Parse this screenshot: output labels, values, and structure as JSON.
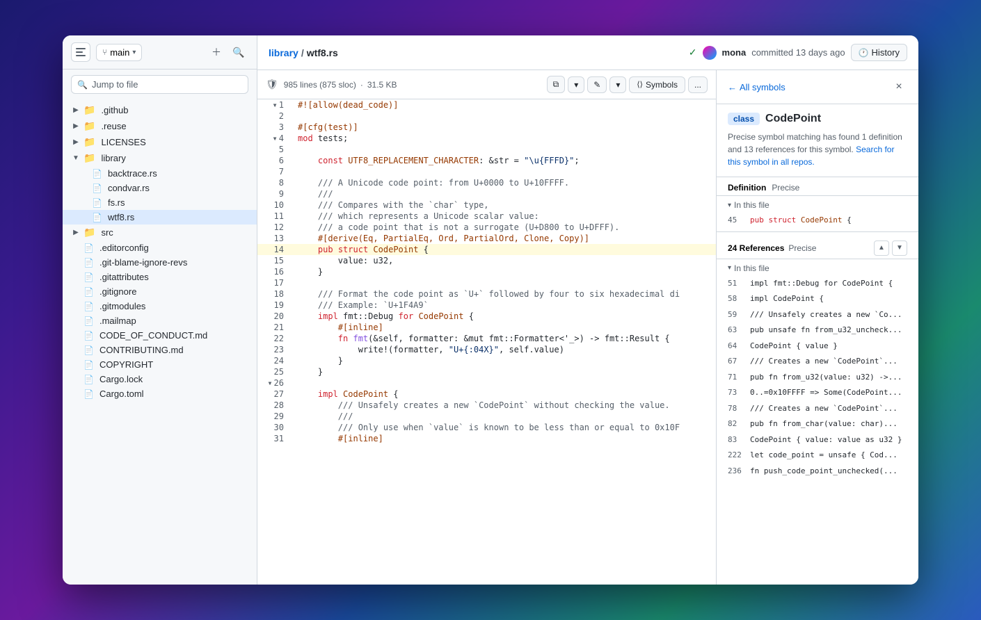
{
  "window": {
    "title": "wtf8.rs"
  },
  "sidebar": {
    "branch": "main",
    "search_placeholder": "Jump to file",
    "items": [
      {
        "id": "github",
        "label": ".github",
        "type": "folder",
        "indent": 0,
        "collapsed": true
      },
      {
        "id": "reuse",
        "label": ".reuse",
        "type": "folder",
        "indent": 0,
        "collapsed": true
      },
      {
        "id": "licenses",
        "label": "LICENSES",
        "type": "folder",
        "indent": 0,
        "collapsed": true
      },
      {
        "id": "library",
        "label": "library",
        "type": "folder",
        "indent": 0,
        "collapsed": false
      },
      {
        "id": "backtrace",
        "label": "backtrace.rs",
        "type": "file",
        "indent": 1
      },
      {
        "id": "condvar",
        "label": "condvar.rs",
        "type": "file",
        "indent": 1
      },
      {
        "id": "fs",
        "label": "fs.rs",
        "type": "file",
        "indent": 1
      },
      {
        "id": "wtf8",
        "label": "wtf8.rs",
        "type": "file",
        "indent": 1,
        "selected": true
      },
      {
        "id": "src",
        "label": "src",
        "type": "folder",
        "indent": 0,
        "collapsed": true
      },
      {
        "id": "editorconfig",
        "label": ".editorconfig",
        "type": "file",
        "indent": 0
      },
      {
        "id": "gitblame",
        "label": ".git-blame-ignore-revs",
        "type": "file",
        "indent": 0
      },
      {
        "id": "gitattributes",
        "label": ".gitattributes",
        "type": "file",
        "indent": 0
      },
      {
        "id": "gitignore",
        "label": ".gitignore",
        "type": "file",
        "indent": 0
      },
      {
        "id": "gitmodules",
        "label": ".gitmodules",
        "type": "file",
        "indent": 0
      },
      {
        "id": "mailmap",
        "label": ".mailmap",
        "type": "file",
        "indent": 0
      },
      {
        "id": "codeofconduct",
        "label": "CODE_OF_CONDUCT.md",
        "type": "file",
        "indent": 0
      },
      {
        "id": "contributing",
        "label": "CONTRIBUTING.md",
        "type": "file",
        "indent": 0
      },
      {
        "id": "copyright",
        "label": "COPYRIGHT",
        "type": "file",
        "indent": 0
      },
      {
        "id": "cargolock",
        "label": "Cargo.lock",
        "type": "file",
        "indent": 0
      },
      {
        "id": "cargotoml",
        "label": "Cargo.toml",
        "type": "file",
        "indent": 0
      }
    ]
  },
  "header": {
    "breadcrumb_base": "library",
    "breadcrumb_sep": "/",
    "breadcrumb_file": "wtf8.rs",
    "commit_user": "mona",
    "commit_time": "committed 13 days ago",
    "history_label": "History"
  },
  "code_toolbar": {
    "lines": "985 lines (875 sloc)",
    "size": "31.5 KB",
    "symbols_label": "Symbols",
    "raw_label": "Raw",
    "edit_label": "Edit",
    "more_label": "..."
  },
  "code_lines": [
    {
      "num": 1,
      "collapsed": true,
      "code": "#![allow(dead_code)]",
      "tokens": [
        {
          "t": "attr",
          "v": "#![allow(dead_code)]"
        }
      ]
    },
    {
      "num": 2,
      "code": ""
    },
    {
      "num": 3,
      "code": "#[cfg(test)]",
      "tokens": [
        {
          "t": "attr",
          "v": "#[cfg(test)]"
        }
      ]
    },
    {
      "num": 4,
      "collapsed": true,
      "code": "mod tests;",
      "tokens": [
        {
          "t": "kw",
          "v": "mod"
        },
        {
          "t": "normal",
          "v": " tests;"
        }
      ]
    },
    {
      "num": 5,
      "code": ""
    },
    {
      "num": 6,
      "code": "    const UTF8_REPLACEMENT_CHARACTER: &str = \"\\u{FFFD}\";",
      "tokens": [
        {
          "t": "normal",
          "v": "    "
        },
        {
          "t": "kw",
          "v": "const"
        },
        {
          "t": "normal",
          "v": " "
        },
        {
          "t": "type",
          "v": "UTF8_REPLACEMENT_CHARACTER"
        },
        {
          "t": "normal",
          "v": ": &str = "
        },
        {
          "t": "str",
          "v": "\"\\u{FFFD}\""
        },
        {
          "t": "normal",
          "v": ";"
        }
      ]
    },
    {
      "num": 7,
      "code": ""
    },
    {
      "num": 8,
      "code": "    /// A Unicode code point: from U+0000 to U+10FFFF.",
      "tokens": [
        {
          "t": "comment",
          "v": "    /// A Unicode code point: from U+0000 to U+10FFFF."
        }
      ]
    },
    {
      "num": 9,
      "code": "    ///",
      "tokens": [
        {
          "t": "comment",
          "v": "    ///"
        }
      ]
    },
    {
      "num": 10,
      "code": "    /// Compares with the `char` type,",
      "tokens": [
        {
          "t": "comment",
          "v": "    /// Compares with the `char` type,"
        }
      ]
    },
    {
      "num": 11,
      "code": "    /// which represents a Unicode scalar value:",
      "tokens": [
        {
          "t": "comment",
          "v": "    /// which represents a Unicode scalar value:"
        }
      ]
    },
    {
      "num": 12,
      "code": "    /// a code point that is not a surrogate (U+D800 to U+DFFF).",
      "tokens": [
        {
          "t": "comment",
          "v": "    /// a code point that is not a surrogate (U+D800 to U+DFFF)."
        }
      ]
    },
    {
      "num": 13,
      "code": "    #[derive(Eq, PartialEq, Ord, PartialOrd, Clone, Copy)]",
      "tokens": [
        {
          "t": "attr",
          "v": "    #[derive(Eq, PartialEq, Ord, PartialOrd, Clone, Copy)]"
        }
      ]
    },
    {
      "num": 14,
      "code": "    pub struct CodePoint {",
      "highlight": true,
      "tokens": [
        {
          "t": "normal",
          "v": "    "
        },
        {
          "t": "kw",
          "v": "pub"
        },
        {
          "t": "normal",
          "v": " "
        },
        {
          "t": "kw",
          "v": "struct"
        },
        {
          "t": "normal",
          "v": " "
        },
        {
          "t": "type",
          "v": "CodePoint"
        },
        {
          "t": "normal",
          "v": " {"
        }
      ]
    },
    {
      "num": 15,
      "code": "        value: u32,",
      "tokens": [
        {
          "t": "normal",
          "v": "        value: u32,"
        }
      ]
    },
    {
      "num": 16,
      "code": "    }",
      "tokens": [
        {
          "t": "normal",
          "v": "    }"
        }
      ]
    },
    {
      "num": 17,
      "code": ""
    },
    {
      "num": 18,
      "code": "    /// Format the code point as `U+` followed by four to six hexadecimal di",
      "tokens": [
        {
          "t": "comment",
          "v": "    /// Format the code point as `U+` followed by four to six hexadecimal di"
        }
      ]
    },
    {
      "num": 19,
      "code": "    /// Example: `U+1F4A9`",
      "tokens": [
        {
          "t": "comment",
          "v": "    /// Example: `U+1F4A9`"
        }
      ]
    },
    {
      "num": 20,
      "code": "    impl fmt::Debug for CodePoint {",
      "tokens": [
        {
          "t": "normal",
          "v": "    "
        },
        {
          "t": "kw",
          "v": "impl"
        },
        {
          "t": "normal",
          "v": " fmt::Debug "
        },
        {
          "t": "kw",
          "v": "for"
        },
        {
          "t": "normal",
          "v": " "
        },
        {
          "t": "type",
          "v": "CodePoint"
        },
        {
          "t": "normal",
          "v": " {"
        }
      ]
    },
    {
      "num": 21,
      "code": "        #[inline]",
      "tokens": [
        {
          "t": "attr",
          "v": "        #[inline]"
        }
      ]
    },
    {
      "num": 22,
      "code": "        fn fmt(&self, formatter: &mut fmt::Formatter<'_>) -> fmt::Result {",
      "tokens": [
        {
          "t": "normal",
          "v": "        "
        },
        {
          "t": "kw",
          "v": "fn"
        },
        {
          "t": "normal",
          "v": " "
        },
        {
          "t": "fn",
          "v": "fmt"
        },
        {
          "t": "normal",
          "v": "(&self, formatter: &mut fmt::Formatter<'_>) -> fmt::Result {"
        }
      ]
    },
    {
      "num": 23,
      "code": "            write!(formatter, \"U+{:04X}\", self.value)",
      "tokens": [
        {
          "t": "normal",
          "v": "            write!(formatter, "
        },
        {
          "t": "str",
          "v": "\"U+{:04X}\""
        },
        {
          "t": "normal",
          "v": ", self.value)"
        }
      ]
    },
    {
      "num": 24,
      "code": "        }",
      "tokens": [
        {
          "t": "normal",
          "v": "        }"
        }
      ]
    },
    {
      "num": 25,
      "code": "    }",
      "tokens": [
        {
          "t": "normal",
          "v": "    }"
        }
      ]
    },
    {
      "num": 26,
      "collapsed": true,
      "code": ""
    },
    {
      "num": 27,
      "code": "    impl CodePoint {",
      "tokens": [
        {
          "t": "normal",
          "v": "    "
        },
        {
          "t": "kw",
          "v": "impl"
        },
        {
          "t": "normal",
          "v": " "
        },
        {
          "t": "type",
          "v": "CodePoint"
        },
        {
          "t": "normal",
          "v": " {"
        }
      ]
    },
    {
      "num": 28,
      "code": "        /// Unsafely creates a new `CodePoint` without checking the value.",
      "tokens": [
        {
          "t": "comment",
          "v": "        /// Unsafely creates a new `CodePoint` without checking the value."
        }
      ]
    },
    {
      "num": 29,
      "code": "        ///",
      "tokens": [
        {
          "t": "comment",
          "v": "        ///"
        }
      ]
    },
    {
      "num": 30,
      "code": "        /// Only use when `value` is known to be less than or equal to 0x10F",
      "tokens": [
        {
          "t": "comment",
          "v": "        /// Only use when `value` is known to be less than or equal to 0x10F"
        }
      ]
    },
    {
      "num": 31,
      "code": "        #[inline]",
      "tokens": [
        {
          "t": "attr",
          "v": "        #[inline]"
        }
      ]
    }
  ],
  "symbols_panel": {
    "back_label": "All symbols",
    "class_badge": "class",
    "symbol_name": "CodePoint",
    "description": "Precise symbol matching has found 1 definition and 13 references for this symbol.",
    "search_link": "Search for this symbol in all repos.",
    "definition_label": "Definition",
    "definition_type": "Precise",
    "in_this_file_1": "In this file",
    "def_line": "45",
    "def_code": "pub struct CodePoint {",
    "refs_count": "24 References",
    "refs_type": "Precise",
    "in_this_file_2": "In this file",
    "references": [
      {
        "line": "51",
        "code": "impl fmt::Debug for CodePoint {"
      },
      {
        "line": "58",
        "code": "impl CodePoint {"
      },
      {
        "line": "59",
        "code": "/// Unsafely creates a new `Co..."
      },
      {
        "line": "63",
        "code": "pub unsafe fn from_u32_uncheck..."
      },
      {
        "line": "64",
        "code": "CodePoint { value }"
      },
      {
        "line": "67",
        "code": "/// Creates a new `CodePoint`..."
      },
      {
        "line": "71",
        "code": "pub fn from_u32(value: u32) ->..."
      },
      {
        "line": "73",
        "code": "0..=0x10FFFF => Some(CodePoint..."
      },
      {
        "line": "78",
        "code": "/// Creates a new `CodePoint`..."
      },
      {
        "line": "82",
        "code": "pub fn from_char(value: char)..."
      },
      {
        "line": "83",
        "code": "CodePoint { value: value as u32 }"
      },
      {
        "line": "222",
        "code": "let code_point = unsafe { Cod..."
      },
      {
        "line": "236",
        "code": "fn push_code_point_unchecked(..."
      }
    ]
  }
}
